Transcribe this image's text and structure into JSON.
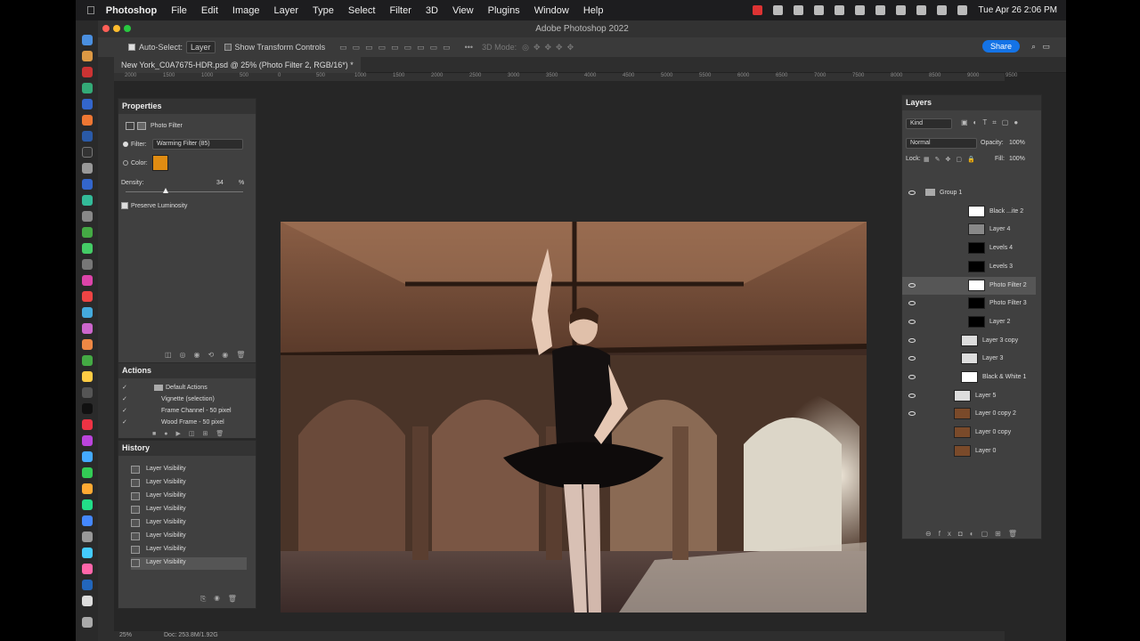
{
  "menubar": {
    "app": "Photoshop",
    "items": [
      "File",
      "Edit",
      "Image",
      "Layer",
      "Type",
      "Select",
      "Filter",
      "3D",
      "View",
      "Plugins",
      "Window",
      "Help"
    ],
    "datetime": "Tue Apr 26  2:06 PM"
  },
  "window": {
    "title": "Adobe Photoshop 2022"
  },
  "options": {
    "auto_select_label": "Auto-Select:",
    "auto_select_value": "Layer",
    "show_transform": "Show Transform Controls",
    "mode_3d": "3D Mode:",
    "share": "Share"
  },
  "document": {
    "tab": "New York_C0A7675-HDR.psd @ 25% (Photo Filter 2, RGB/16*) *",
    "zoom": "25%",
    "doc_info": "Doc: 253.8M/1.92G",
    "ruler_ticks": [
      "2000",
      "1500",
      "1000",
      "500",
      "0",
      "500",
      "1000",
      "1500",
      "2000",
      "2500",
      "3000",
      "3500",
      "4000",
      "4500",
      "5000",
      "5500",
      "6000",
      "6500",
      "7000",
      "7500",
      "8000",
      "8500",
      "9000",
      "9500"
    ]
  },
  "properties": {
    "title": "Properties",
    "subtitle": "Photo Filter",
    "filter_label": "Filter:",
    "filter_value": "Warming Filter (85)",
    "color_label": "Color:",
    "color_swatch": "#e08c12",
    "density_label": "Density:",
    "density_value": "34",
    "density_unit": "%",
    "density_fraction": 0.34,
    "preserve_label": "Preserve Luminosity"
  },
  "actions": {
    "title": "Actions",
    "items": [
      "Default Actions",
      "Vignette (selection)",
      "Frame Channel - 50 pixel",
      "Wood Frame - 50 pixel"
    ]
  },
  "history": {
    "title": "History",
    "items": [
      "Layer Visibility",
      "Layer Visibility",
      "Layer Visibility",
      "Layer Visibility",
      "Layer Visibility",
      "Layer Visibility",
      "Layer Visibility",
      "Layer Visibility"
    ]
  },
  "layers": {
    "title": "Layers",
    "kind": "Kind",
    "blend": "Normal",
    "opacity_label": "Opacity:",
    "opacity": "100%",
    "lock_label": "Lock:",
    "fill_label": "Fill:",
    "fill": "100%",
    "items": [
      {
        "name": "Group 1"
      },
      {
        "name": "Black ...ite 2"
      },
      {
        "name": "Layer 4"
      },
      {
        "name": "Levels 4"
      },
      {
        "name": "Levels 3"
      },
      {
        "name": "Photo Filter 2"
      },
      {
        "name": "Photo Filter 3"
      },
      {
        "name": "Layer 2"
      },
      {
        "name": "Layer 3 copy"
      },
      {
        "name": "Layer 3"
      },
      {
        "name": "Black & White 1"
      },
      {
        "name": "Layer 5"
      },
      {
        "name": "Layer 0 copy 2"
      },
      {
        "name": "Layer 0 copy"
      },
      {
        "name": "Layer 0"
      }
    ]
  },
  "colors": {
    "accent": "#1473e6",
    "panel": "#404040",
    "canvas": "#262626"
  }
}
